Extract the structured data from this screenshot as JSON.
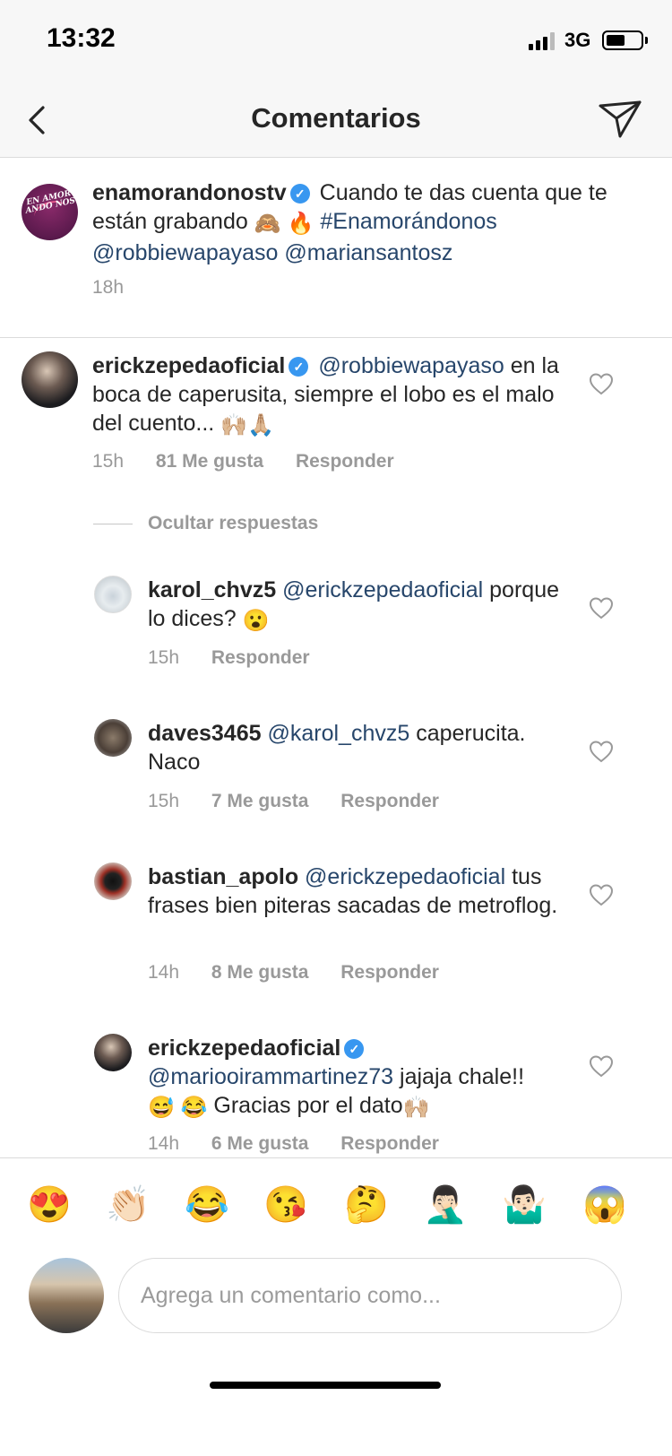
{
  "status_bar": {
    "time": "13:32",
    "network": "3G"
  },
  "header": {
    "title": "Comentarios",
    "back_icon": "chevron-left-icon",
    "send_icon": "paper-plane-icon"
  },
  "caption": {
    "username": "enamorandonostv",
    "text_1": "Cuando te das cuenta que te están grabando",
    "emoji_1": "🙈",
    "emoji_2": "🔥",
    "hashtag": "#Enamorándonos",
    "mention_1": "@robbiewapayaso",
    "mention_2": "@mariansantosz",
    "time_ago": "18h",
    "avatar_text": "EN AMOR ANDO NOS"
  },
  "comment": {
    "username": "erickzepedaoficial",
    "mention": "@robbiewapayaso",
    "text": "en la boca de caperusita, siempre el lobo es el malo del cuento...",
    "emoji": "🙌🏼🙏🏼",
    "time_ago": "15h",
    "likes": "81 Me gusta",
    "reply_label": "Responder"
  },
  "hide_replies_label": "Ocultar respuestas",
  "replies": [
    {
      "username": "karol_chvz5",
      "mention": "@erickzepedaoficial",
      "text": "porque lo dices?",
      "emoji": "😮",
      "time_ago": "15h",
      "likes": "",
      "reply_label": "Responder"
    },
    {
      "username": "daves3465",
      "mention": "@karol_chvz5",
      "text": "caperucita. Naco",
      "emoji": "",
      "time_ago": "15h",
      "likes": "7 Me gusta",
      "reply_label": "Responder"
    },
    {
      "username": "bastian_apolo",
      "mention": "@erickzepedaoficial",
      "text": "tus frases bien piteras sacadas de metroflog.",
      "emoji": "",
      "time_ago": "14h",
      "likes": "8 Me gusta",
      "reply_label": "Responder"
    },
    {
      "username": "erickzepedaoficial",
      "mention": "@mariooirammartinez73",
      "text_1": "jajaja chale!!",
      "emoji_1": "😅 😂",
      "text_2": "Gracias por el dato",
      "emoji_2": "🙌🏼",
      "time_ago": "14h",
      "likes": "6 Me gusta",
      "reply_label": "Responder"
    }
  ],
  "emoji_bar": [
    "😍",
    "👏🏻",
    "😂",
    "😘",
    "🤔",
    "🤦🏻‍♂️",
    "🤷🏻‍♂️",
    "😱"
  ],
  "composer": {
    "placeholder": "Agrega un comentario como..."
  },
  "colors": {
    "mention": "#27466b",
    "secondary_text": "#999999",
    "verified": "#3897f0",
    "divider": "#dbdbdb"
  }
}
